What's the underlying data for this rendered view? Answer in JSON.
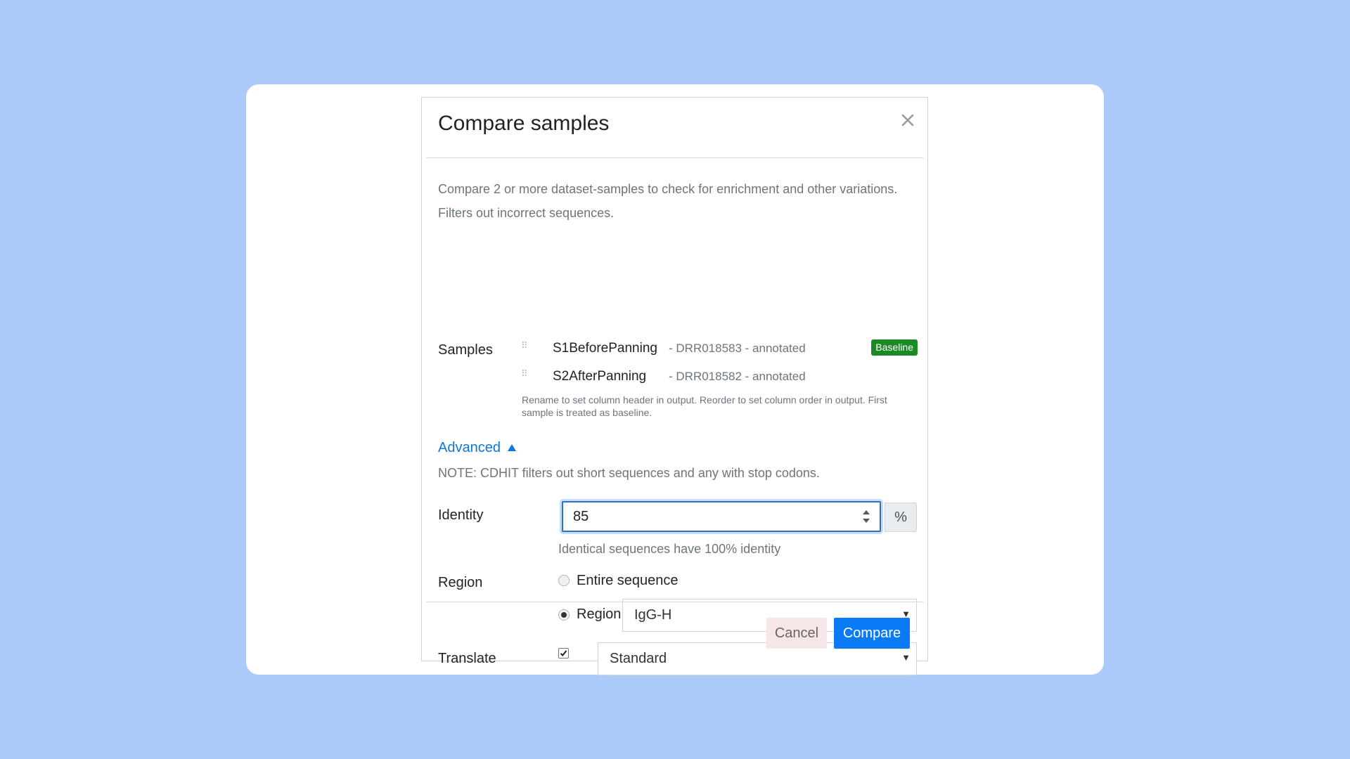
{
  "dialog": {
    "title": "Compare samples",
    "close_icon": "close-icon",
    "description_line1": "Compare 2 or more dataset-samples to check for enrichment and other variations.",
    "description_line2": "Filters out incorrect sequences."
  },
  "samples": {
    "label": "Samples",
    "items": [
      {
        "name": "S1BeforePanning",
        "meta": "- DRR018583 - annotated",
        "badge": "Baseline"
      },
      {
        "name": "S2AfterPanning",
        "meta": "- DRR018582 - annotated",
        "badge": ""
      }
    ],
    "help": "Rename to set column header in output. Reorder to set column order in output. First sample is treated as baseline."
  },
  "advanced": {
    "label": "Advanced",
    "icon": "triangle-up-icon",
    "note": "NOTE: CDHIT filters out short sequences and any with stop codons."
  },
  "identity": {
    "label": "Identity",
    "value": "85",
    "unit": "%",
    "help": "Identical sequences have 100% identity"
  },
  "region": {
    "label": "Region",
    "options": [
      "Entire sequence",
      "Region"
    ],
    "selected_option": "Region",
    "select_value": "IgG-H"
  },
  "translate": {
    "label": "Translate",
    "checked": true,
    "select_value": "Standard"
  },
  "footer": {
    "cancel_label": "Cancel",
    "compare_label": "Compare"
  },
  "colors": {
    "background": "#abc9f9",
    "primary": "#0a7bf5",
    "link": "#1177d8",
    "badge": "#1c8a24",
    "cancel_bg": "#f7e6e6"
  }
}
